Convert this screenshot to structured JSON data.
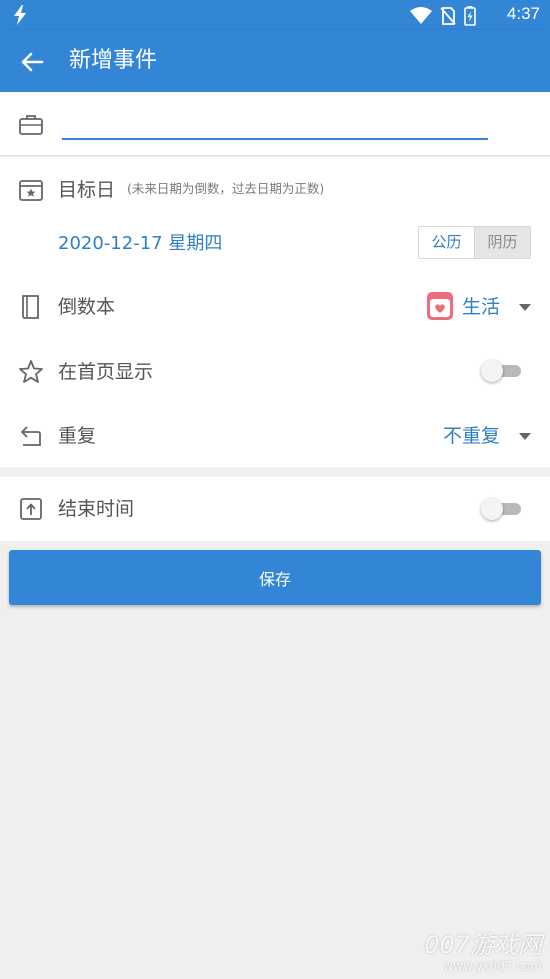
{
  "status_bar": {
    "time": "4:37",
    "icons": [
      "flash-icon",
      "wifi-icon",
      "no-sim-icon",
      "battery-charging-icon"
    ]
  },
  "app_bar": {
    "title": "新增事件",
    "back_icon": "arrow-back-icon"
  },
  "name_field": {
    "value": "",
    "placeholder": "",
    "icon": "briefcase-icon"
  },
  "target_date": {
    "label": "目标日",
    "hint": "(未来日期为倒数，过去日期为正数)",
    "date": "2020-12-17 星期四",
    "calendar_options": [
      "公历",
      "阴历"
    ],
    "selected_calendar": "公历"
  },
  "countdown_book": {
    "label": "倒数本",
    "value": "生活"
  },
  "show_on_home": {
    "label": "在首页显示",
    "enabled": false
  },
  "repeat": {
    "label": "重复",
    "value": "不重复"
  },
  "end_time": {
    "label": "结束时间",
    "enabled": false
  },
  "save_button": {
    "label": "保存"
  },
  "watermark": {
    "main": "007游戏网",
    "sub": "www.yx007.com"
  },
  "colors": {
    "primary": "#3385d6",
    "accent_text": "#2f7fc4",
    "background": "#f0efee",
    "book_icon": "#f06b7b"
  }
}
